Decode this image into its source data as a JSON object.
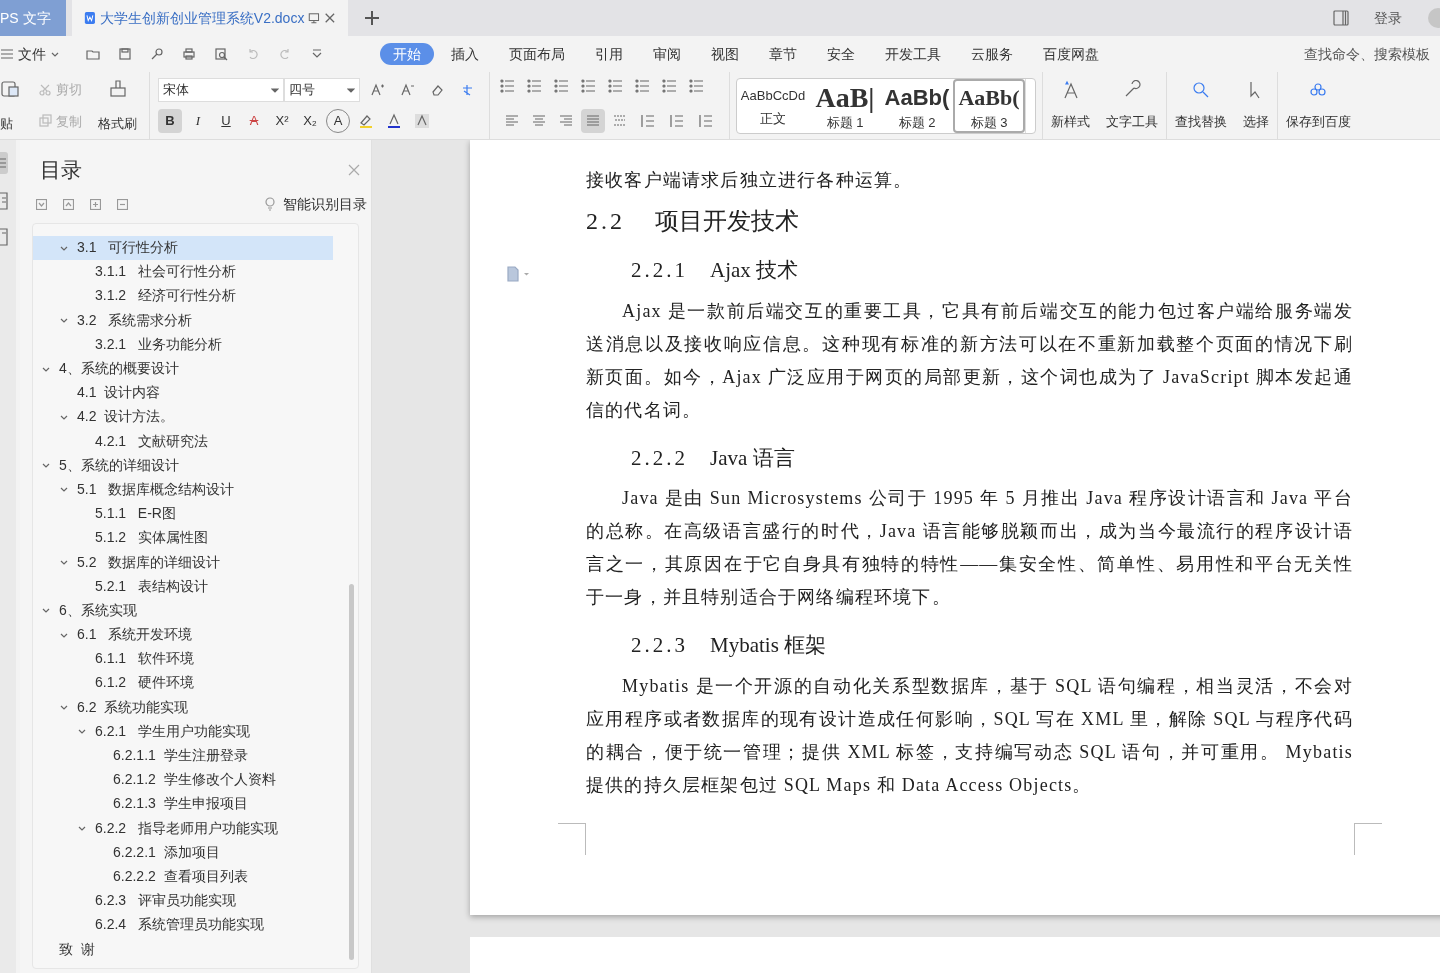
{
  "title_bar": {
    "app_tab": "PS 文字",
    "doc_tab": {
      "title": "大学生创新创业管理系统V2.docx",
      "selected": true
    },
    "login": "登录"
  },
  "menu": {
    "file": "文件",
    "tabs": [
      {
        "label": "开始",
        "selected": true
      },
      {
        "label": "插入",
        "selected": false
      },
      {
        "label": "页面布局",
        "selected": false
      },
      {
        "label": "引用",
        "selected": false
      },
      {
        "label": "审阅",
        "selected": false
      },
      {
        "label": "视图",
        "selected": false
      },
      {
        "label": "章节",
        "selected": false
      },
      {
        "label": "安全",
        "selected": false
      },
      {
        "label": "开发工具",
        "selected": false
      },
      {
        "label": "云服务",
        "selected": false
      },
      {
        "label": "百度网盘",
        "selected": false
      }
    ],
    "search": {
      "placeholder": "查找命令、搜索模板"
    }
  },
  "ribbon": {
    "paste": "贴",
    "cut": {
      "label": "剪切",
      "disabled": true
    },
    "copy": {
      "label": "复制",
      "disabled": true
    },
    "format_painter": "格式刷",
    "font_name": "宋体",
    "font_size": "四号",
    "format_buttons": [
      {
        "label": "B",
        "selected": true
      },
      {
        "label": "I",
        "selected": false
      },
      {
        "label": "U",
        "selected": false
      },
      {
        "label": "A",
        "selected": false
      },
      {
        "label": "X²",
        "selected": false
      },
      {
        "label": "X₂",
        "selected": false
      },
      {
        "label": "A",
        "selected": false
      }
    ],
    "align_buttons": [
      {
        "selected": false
      },
      {
        "selected": false
      },
      {
        "selected": false
      },
      {
        "selected": true
      },
      {
        "selected": false
      }
    ],
    "styles": [
      {
        "preview": "AaBbCcDd",
        "label": "正文",
        "kind": "normal",
        "selected": false
      },
      {
        "preview": "AaB|",
        "label": "标题 1",
        "kind": "h1",
        "selected": false
      },
      {
        "preview": "AaBb(",
        "label": "标题 2",
        "kind": "h2",
        "selected": false
      },
      {
        "preview": "AaBb(",
        "label": "标题 3",
        "kind": "h3",
        "selected": true
      }
    ],
    "tools": [
      "新样式",
      "文字工具",
      "查找替换",
      "选择",
      "保存到百度"
    ]
  },
  "toc": {
    "title": "目录",
    "smart_button": "智能识别目录",
    "items": [
      {
        "children": [
          {
            "label": "3.1   可行性分析",
            "expanded": true,
            "selected": true,
            "children": [
              {
                "label": "3.1.1   社会可行性分析",
                "selected": false
              },
              {
                "label": "3.1.2   经济可行性分析",
                "selected": false
              }
            ]
          },
          {
            "label": "3.2   系统需求分析",
            "expanded": true,
            "selected": false,
            "children": [
              {
                "label": "3.2.1   业务功能分析",
                "selected": false
              }
            ]
          }
        ]
      },
      {
        "label": "4、系统的概要设计",
        "expanded": true,
        "selected": false,
        "children": [
          {
            "label": "4.1  设计内容",
            "selected": false
          },
          {
            "label": "4.2  设计方法。",
            "expanded": true,
            "selected": false,
            "children": [
              {
                "label": "4.2.1   文献研究法",
                "selected": false
              }
            ]
          }
        ]
      },
      {
        "label": "5、系统的详细设计",
        "expanded": true,
        "selected": false,
        "children": [
          {
            "label": "5.1   数据库概念结构设计",
            "expanded": true,
            "selected": false,
            "children": [
              {
                "label": "5.1.1   E-R图",
                "selected": false
              },
              {
                "label": "5.1.2   实体属性图",
                "selected": false
              }
            ]
          },
          {
            "label": "5.2   数据库的详细设计",
            "expanded": true,
            "selected": false,
            "children": [
              {
                "label": "5.2.1   表结构设计",
                "selected": false
              }
            ]
          }
        ]
      },
      {
        "label": "6、系统实现",
        "expanded": true,
        "selected": false,
        "children": [
          {
            "label": "6.1   系统开发环境",
            "expanded": true,
            "selected": false,
            "children": [
              {
                "label": "6.1.1   软件环境",
                "selected": false
              },
              {
                "label": "6.1.2   硬件环境",
                "selected": false
              }
            ]
          },
          {
            "label": "6.2  系统功能实现",
            "expanded": true,
            "selected": false,
            "children": [
              {
                "label": "6.2.1   学生用户功能实现",
                "expanded": true,
                "selected": false,
                "children": [
                  {
                    "label": "6.2.1.1  学生注册登录",
                    "selected": false
                  },
                  {
                    "label": "6.2.1.2  学生修改个人资料",
                    "selected": false
                  },
                  {
                    "label": "6.2.1.3  学生申报项目",
                    "selected": false
                  }
                ]
              },
              {
                "label": "6.2.2   指导老师用户功能实现",
                "expanded": true,
                "selected": false,
                "children": [
                  {
                    "label": "6.2.2.1  添加项目",
                    "selected": false
                  },
                  {
                    "label": "6.2.2.2  查看项目列表",
                    "selected": false
                  }
                ]
              },
              {
                "label": "6.2.3   评审员功能实现",
                "selected": false
              },
              {
                "label": "6.2.4   系统管理员功能实现",
                "selected": false
              }
            ]
          }
        ]
      },
      {
        "label": "致  谢",
        "selected": false
      }
    ]
  },
  "document": {
    "blocks": [
      {
        "kind": "paragraph",
        "text": "接收客户端请求后独立进行各种运算。",
        "indent": false
      },
      {
        "kind": "heading2",
        "number": "2.2",
        "title": "项目开发技术"
      },
      {
        "kind": "heading3",
        "number": "2.2.1",
        "title": "Ajax 技术"
      },
      {
        "kind": "paragraph",
        "text": "Ajax 是一款前后端交互的重要工具，它具有前后端交互的能力包过客户端给服务端发送消息以及接收响应信息。这种现有标准的新方法可以在不重新加载整个页面的情况下刷新页面。如今，Ajax 广泛应用于网页的局部更新，这个词也成为了 JavaScript 脚本发起通信的代名词。",
        "indent": true
      },
      {
        "kind": "heading3",
        "number": "2.2.2",
        "title": "Java 语言"
      },
      {
        "kind": "paragraph",
        "text": "Java 是由 Sun Microsystems 公司于 1995 年 5 月推出 Java 程序设计语言和 Java 平台的总称。在高级语言盛行的时代，Java 语言能够脱颖而出，成为当今最流行的程序设计语言之一，其原因在于它自身具有独特的特性——集安全性、简单性、易用性和平台无关性于一身，并且特别适合于网络编程环境下。",
        "indent": true
      },
      {
        "kind": "heading3",
        "number": "2.2.3",
        "title": "Mybatis 框架"
      },
      {
        "kind": "paragraph",
        "text": "Mybatis 是一个开源的自动化关系型数据库，基于 SQL 语句编程，相当灵活，不会对应用程序或者数据库的现有设计造成任何影响，SQL 写在 XML 里，解除 SQL 与程序代码的耦合，便于统一管理；提供 XML 标签，支持编写动态 SQL 语句，并可重用。 Mybatis 提供的持久层框架包过 SQL Maps 和 Data Access Objects。",
        "indent": true
      }
    ]
  }
}
